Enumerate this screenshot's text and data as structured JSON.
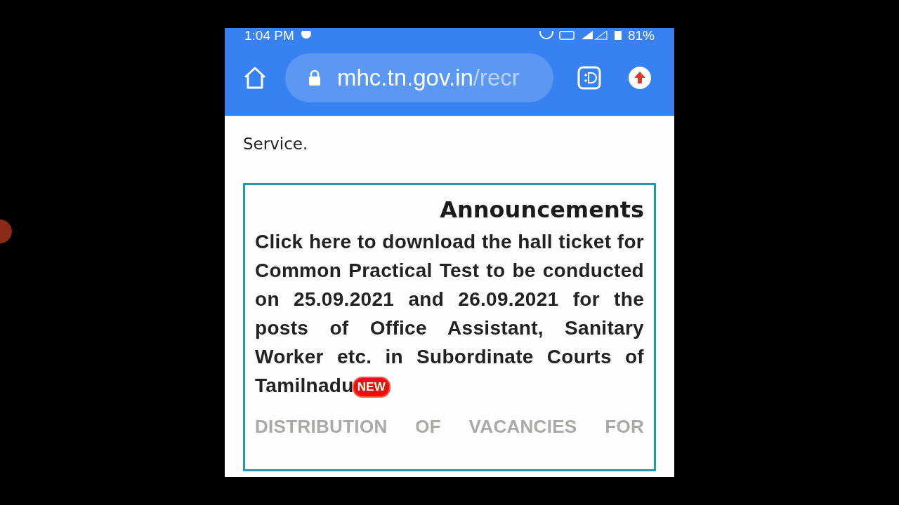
{
  "status_bar": {
    "time": "1:04 PM",
    "battery": "81%"
  },
  "browser_bar": {
    "url_host": "mhc.tn.gov.in",
    "url_path": "/recr"
  },
  "article": {
    "lines": [
      "Service."
    ]
  },
  "announcements": {
    "title": "Announcements",
    "items": [
      {
        "text": "Click here to download the hall ticket for Common Practical Test to be conducted on 25.09.2021 and 26.09.2021 for the posts of Office Assistant, Sanitary Worker etc. in Subordinate Courts of Tamilnadu",
        "greyed": false,
        "badge": "NEW"
      },
      {
        "text": "DISTRIBUTION OF VACANCIES FOR",
        "greyed": true
      }
    ]
  }
}
